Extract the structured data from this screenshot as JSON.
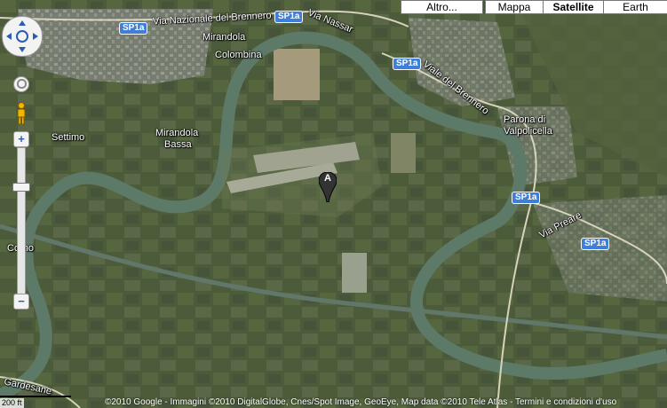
{
  "map_type_controls": [
    {
      "label": "Altro...",
      "active": false
    },
    {
      "label": "Mappa",
      "active": false
    },
    {
      "label": "Satellite",
      "active": true
    },
    {
      "label": "Earth",
      "active": false
    }
  ],
  "navigation": {
    "zoom_in": "+",
    "zoom_out": "−"
  },
  "places": {
    "mirandola": "Mirandola",
    "colombina": "Colombina",
    "settimo": "Settimo",
    "mirandola_bassa_1": "Mirandola",
    "mirandola_bassa_2": "Bassa",
    "parona_1": "Parona di",
    "parona_2": "Valpolicella",
    "corno": "Corno"
  },
  "roads": {
    "via_nazionale": "Via Nazionale del Brennero",
    "via_nassar": "Via Nassar",
    "viale_brennero": "Viale del Brennero",
    "via_preare": "Via Preare",
    "via_gardesane": "Gardesane"
  },
  "route_shields": [
    "SP1a",
    "SP1a",
    "SP1a",
    "SP1a",
    "SP1a"
  ],
  "marker": {
    "label": "A"
  },
  "scale": {
    "label": "200 ft"
  },
  "attribution": "©2010 Google - Immagini ©2010 DigitalGlobe, Cnes/Spot Image, GeoEye, Map data ©2010 Tele Atlas - Termini e condizioni d'uso",
  "colors": {
    "fields": "#4a5a3a",
    "river": "#5f7d6c",
    "runway": "#b9bab2",
    "urban": "#8a8d86",
    "shield": "#3f7fd8"
  }
}
